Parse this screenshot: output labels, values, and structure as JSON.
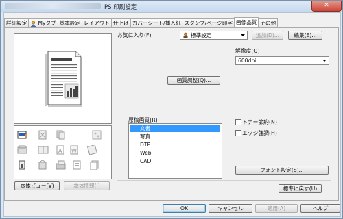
{
  "window": {
    "title": "PS 印刷設定",
    "close_glyph": "✕"
  },
  "tabs": [
    {
      "label": "詳細設定",
      "icon": ""
    },
    {
      "label": "Myタブ",
      "icon": "user-icon"
    },
    {
      "label": "基本設定",
      "icon": ""
    },
    {
      "label": "レイアウト",
      "icon": ""
    },
    {
      "label": "仕上げ",
      "icon": ""
    },
    {
      "label": "カバーシート/挿入紙",
      "icon": ""
    },
    {
      "label": "スタンプ/ページ印字",
      "icon": ""
    },
    {
      "label": "画像品質",
      "icon": "",
      "active": true
    },
    {
      "label": "その他",
      "icon": ""
    }
  ],
  "favorites": {
    "label": "お気に入り(F)",
    "value": "標準設定",
    "add_button": "追加(D)...",
    "edit_button": "編集(E)..."
  },
  "left": {
    "body_view_button": "本体ビュー(V)",
    "body_info_button": "本体情報(I)"
  },
  "image_adjust_button": "画質調整(Q)...",
  "resolution": {
    "label": "解像度(O)",
    "value": "600dpi"
  },
  "original_quality": {
    "label": "原稿画質(R)",
    "items": [
      "文書",
      "写真",
      "DTP",
      "Web",
      "CAD"
    ],
    "selected_index": 0
  },
  "checkboxes": [
    {
      "label": "トナー節約(N)",
      "checked": false
    },
    {
      "label": "エッジ強調(H)",
      "checked": false
    }
  ],
  "font_settings_button": "フォント設定(S)...",
  "restore_default_button": "標準に戻す(U)",
  "footer": {
    "ok": "OK",
    "cancel": "キャンセル",
    "apply": "適用(A)",
    "help": "ヘルプ"
  },
  "colors": {
    "selection": "#3399ff",
    "focus_border": "#3c7fb1"
  }
}
